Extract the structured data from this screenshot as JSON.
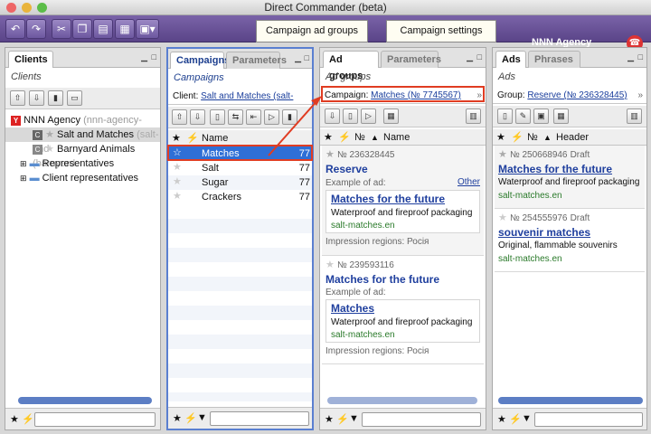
{
  "window": {
    "title": "Direct Commander (beta)"
  },
  "header": {
    "agency": "NNN Agency"
  },
  "clients": {
    "tab": "Clients",
    "subtitle": "Clients",
    "root": "NNN Agency",
    "root_login": "(nnn-agency-eng)",
    "items": [
      {
        "name": "Salt and Matches",
        "login": "(salt-and"
      },
      {
        "name": "Barnyard Animals",
        "login": "(barnyard"
      }
    ],
    "folders": [
      "Representatives",
      "Client representatives"
    ]
  },
  "campaigns": {
    "tab1": "Campaigns",
    "tab2": "Parameters",
    "subtitle": "Campaigns",
    "client_label": "Client:",
    "client_value": "Salt and Matches (salt-and...",
    "col_name": "Name",
    "rows": [
      {
        "name": "Matches",
        "num": "77"
      },
      {
        "name": "Salt",
        "num": "77"
      },
      {
        "name": "Sugar",
        "num": "77"
      },
      {
        "name": "Crackers",
        "num": "77"
      }
    ]
  },
  "adgroups": {
    "tab1": "Ad groups",
    "tab2": "Parameters",
    "subtitle": "Ad groups",
    "campaign_label": "Campaign:",
    "campaign_value": "Matches (№ 7745567)",
    "col_num": "№",
    "col_name": "Name",
    "groups": [
      {
        "num": "№ 236328445",
        "title": "Reserve",
        "example_label": "Example of ad:",
        "other": "Other",
        "ad_title": "Matches for the future",
        "ad_text": "Waterproof and fireproof packaging",
        "ad_url": "salt-matches.en",
        "regions": "Impression regions: Росія"
      },
      {
        "num": "№ 239593116",
        "title": "Matches for the future",
        "example_label": "Example of ad:",
        "ad_title": "Matches",
        "ad_text": "Waterproof and fireproof packaging",
        "ad_url": "salt-matches.en",
        "regions": "Impression regions: Росія"
      }
    ]
  },
  "ads": {
    "tab1": "Ads",
    "tab2": "Phrases",
    "subtitle": "Ads",
    "group_label": "Group:",
    "group_value": "Reserve (№ 236328445)",
    "col_num": "№",
    "col_header": "Header",
    "items": [
      {
        "num": "№ 250668946",
        "status": "Draft",
        "title": "Matches for the future",
        "text": "Waterproof and fireproof packaging",
        "url": "salt-matches.en"
      },
      {
        "num": "№ 254555976",
        "status": "Draft",
        "title": "souvenir matches",
        "text": "Original, flammable souvenirs",
        "url": "salt-matches.en"
      }
    ]
  },
  "callouts": {
    "groups": "Campaign ad groups",
    "settings": "Campaign settings"
  },
  "colors": {
    "accent": "#5a4488",
    "selection": "#2f6fd6",
    "highlight": "#e03c22"
  }
}
